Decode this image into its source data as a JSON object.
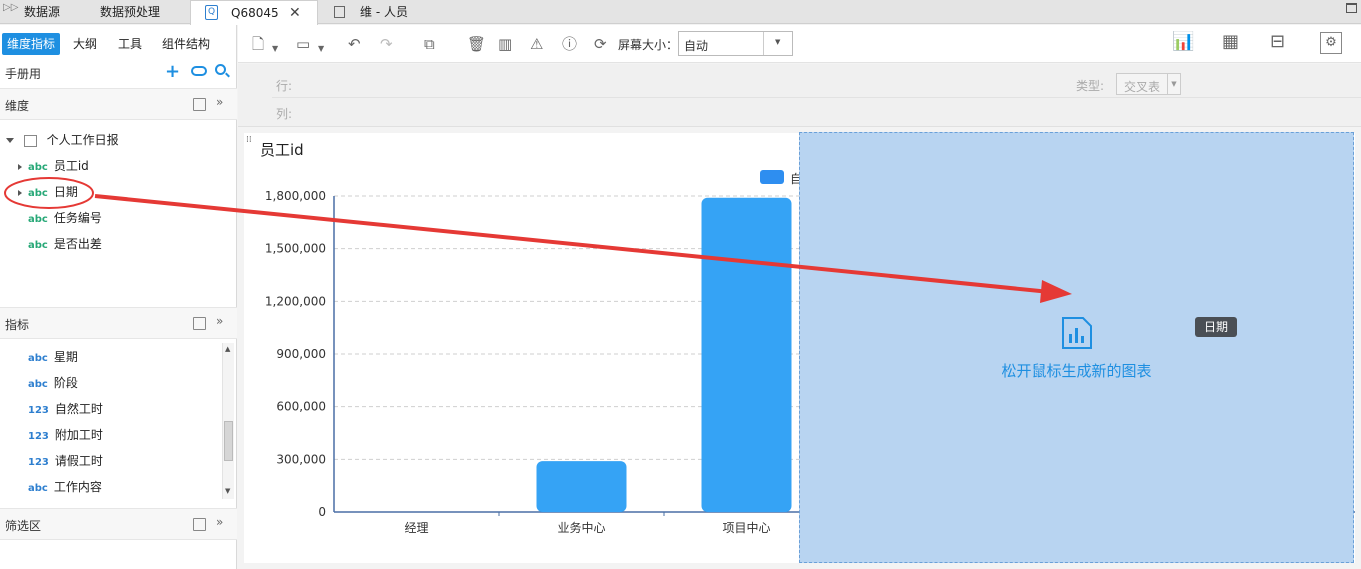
{
  "tabs": [
    {
      "label": "数据源"
    },
    {
      "label": "数据预处理"
    },
    {
      "label": "Q68045"
    },
    {
      "label": "维 - 人员"
    }
  ],
  "left": {
    "subtabs": [
      "维度指标",
      "大纲",
      "工具",
      "组件结构"
    ],
    "source_label": "手册用",
    "dimension": {
      "header": "维度",
      "root": "个人工作日报",
      "items": [
        {
          "type": "abc",
          "label": "员工id"
        },
        {
          "type": "abc",
          "label": "日期"
        },
        {
          "type": "abc",
          "label": "任务编号"
        },
        {
          "type": "abc",
          "label": "是否出差"
        }
      ]
    },
    "measure": {
      "header": "指标",
      "items": [
        {
          "type": "abc",
          "label": "星期"
        },
        {
          "type": "abc",
          "label": "阶段"
        },
        {
          "type": "123",
          "label": "自然工时"
        },
        {
          "type": "123",
          "label": "附加工时"
        },
        {
          "type": "123",
          "label": "请假工时"
        },
        {
          "type": "abc",
          "label": "工作内容"
        }
      ]
    },
    "filter": {
      "header": "筛选区"
    }
  },
  "toolbar": {
    "screen_size_label": "屏幕大小：",
    "screen_size_value": "自动"
  },
  "rowcol": {
    "row_label": "行:",
    "col_label": "列:",
    "type_label": "类型:",
    "type_value": "交叉表"
  },
  "drag": {
    "hint": "松开鼠标生成新的图表",
    "chip": "日期"
  },
  "chart_data": {
    "type": "bar",
    "title": "员工id",
    "categories": [
      "经理",
      "业务中心",
      "项目中心"
    ],
    "values": [
      0,
      290000,
      1790000
    ],
    "ylim": [
      0,
      1800000
    ],
    "yticks": [
      "0",
      "300,000",
      "600,000",
      "900,000",
      "1,200,000",
      "1,500,000",
      "1,800,000"
    ],
    "legend_label": "自",
    "bar_color": "#35a3f5",
    "grid": true
  },
  "colors": {
    "accent": "#1e8fe1",
    "arrow": "#e53935"
  }
}
